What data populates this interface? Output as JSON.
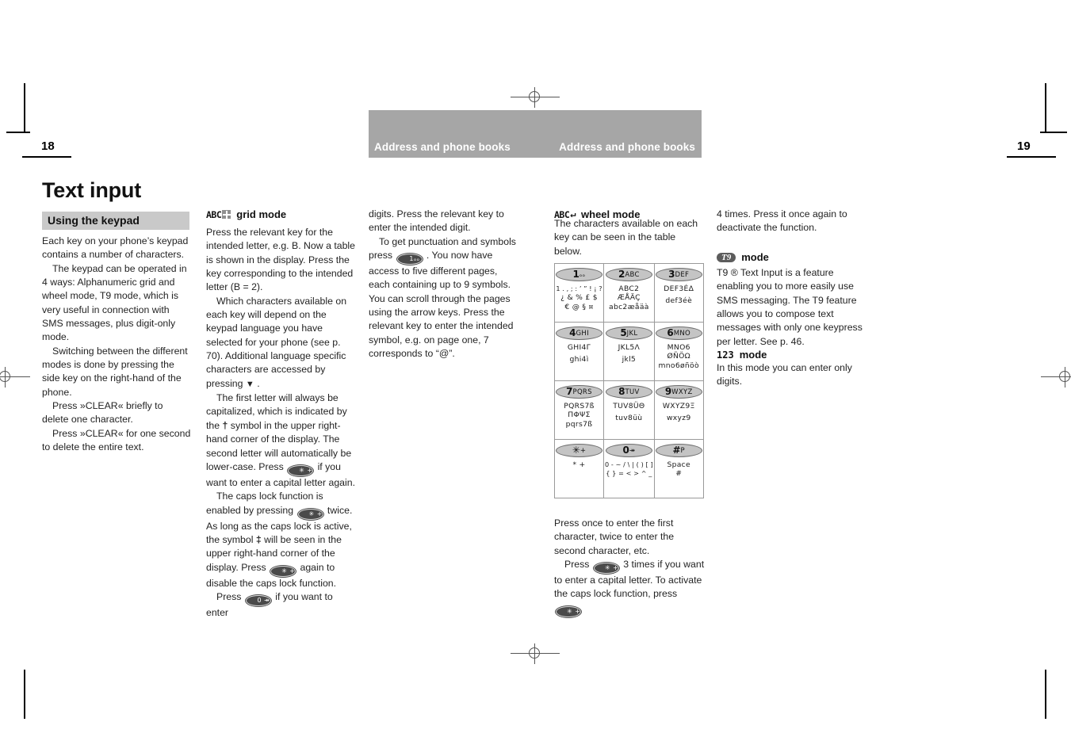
{
  "header": {
    "band_left_title": "Address and phone books",
    "band_right_title": "Address and phone books",
    "folio_left": "18",
    "folio_right": "19"
  },
  "page_title": "Text input",
  "section_band": "Using the keypad",
  "columns": {
    "col1": [
      "Each key on your phone’s keypad contains a number of characters.",
      "The keypad can be operated in 4 ways: Alphanumeric grid and wheel mode, T9 mode, which is very useful in connection with SMS messages, plus digit-only mode.",
      "Switching between the different modes is done by pressing the side key on the right-hand of the phone.",
      "Press »CLEAR« briefly to delete one character.",
      "Press »CLEAR« for one second to delete the entire text."
    ],
    "grid_mode_heading": "grid mode",
    "col2_p1": "Press the relevant key for the intended letter, e.g. B. Now a table is shown in the display. Press the key corresponding to the intended letter (B = 2).",
    "col2_p2_a": "Which characters available on each key will depend on the keypad language you have selected for your phone (see p. 70). Additional language specific characters are accessed by pressing",
    "col2_p2_b": ".",
    "col2_p3_a": "The first letter will always be capitalized, which is indicated by the",
    "col2_p3_b": "symbol in the upper right-hand corner of the display. The second letter will automatically be lower-case. Press",
    "col2_p3_c": "if you want to enter a capital letter again.",
    "col2_p4_a": "The caps lock function is enabled by pressing",
    "col2_p4_b": "twice. As long as the caps lock is active, the symbol",
    "col2_p4_c": "will be seen in the upper right-hand corner of the display. Press",
    "col2_p4_d": "again to disable the caps lock function.",
    "col2_p5_a": "Press",
    "col2_p5_b": "if you want to enter",
    "col3_p1": "digits. Press the relevant key to enter the intended digit.",
    "col3_p2_a": "To get punctuation and symbols press",
    "col3_p2_b": ". You now have access to five different pages, each containing up to 9 symbols. You can scroll through the pages using the arrow keys. Press the relevant key to enter the intended symbol, e.g. on page one, 7 corresponds to “@”.",
    "wheel_mode_heading": "wheel mode",
    "col4_p1": "The characters available on each key can be seen in the table below.",
    "col4_p2": "Press once to enter the first character, twice to enter the second character, etc.",
    "col4_p3_a": "Press",
    "col4_p3_b": "3 times if you want to enter a capital letter. To activate the caps lock function, press",
    "col5_p1": "4 times. Press it once again to deactivate the function.",
    "t9_mode_heading": "mode",
    "t9_badge": "T9",
    "col5_t9": "T9 ® Text Input is a feature enabling you to more easily use SMS messaging. The T9 feature allows you to compose text messages with only one keypress per letter. See p. 46.",
    "mode_123_badge": "123",
    "mode_123_heading": "mode",
    "col5_123": "In this mode you can enter only digits."
  },
  "inline_keys": {
    "star": "✳ +",
    "zero": "0 ↠",
    "one": "1ₒₒ",
    "arrow_down": "▼",
    "dagger": "†",
    "dagger_lock": "‡"
  },
  "keypad_table": {
    "rows": [
      [
        {
          "name": "key-1",
          "cap_digit": "1",
          "cap_letters": "ₒₒ",
          "lines": [
            "1 . , ; : ’ ” ! ¡ ?",
            "¿ & % £ $",
            "€ @ § ¤"
          ]
        },
        {
          "name": "key-2",
          "cap_digit": "2",
          "cap_letters": "ABC",
          "lines": [
            "ABC2",
            "ÆÅÄÇ",
            "abc2æåäà"
          ]
        },
        {
          "name": "key-3",
          "cap_digit": "3",
          "cap_letters": "DEF",
          "lines": [
            "DEF3ÉΔ",
            "",
            "def3éè"
          ]
        }
      ],
      [
        {
          "name": "key-4",
          "cap_digit": "4",
          "cap_letters": "GHI",
          "lines": [
            "GHI4Γ",
            "",
            "ghi4ì"
          ]
        },
        {
          "name": "key-5",
          "cap_digit": "5",
          "cap_letters": "JKL",
          "lines": [
            "JKL5Λ",
            "",
            "jkl5"
          ]
        },
        {
          "name": "key-6",
          "cap_digit": "6",
          "cap_letters": "MNO",
          "lines": [
            "MNO6",
            "ØÑÖΩ",
            "mno6øñöò"
          ]
        }
      ],
      [
        {
          "name": "key-7",
          "cap_digit": "7",
          "cap_letters": "PQRS",
          "lines": [
            "PQRS7ß",
            "ΠΦΨΣ",
            "pqrs7ß"
          ]
        },
        {
          "name": "key-8",
          "cap_digit": "8",
          "cap_letters": "TUV",
          "lines": [
            "TUV8ÜΘ",
            "",
            "tuv8üù"
          ]
        },
        {
          "name": "key-9",
          "cap_digit": "9",
          "cap_letters": "WXYZ",
          "lines": [
            "WXYZ9Ξ",
            "",
            "wxyz9"
          ]
        }
      ],
      [
        {
          "name": "key-star",
          "cap_digit": "✳",
          "cap_letters": "+",
          "lines": [
            "*   +",
            "",
            ""
          ]
        },
        {
          "name": "key-0",
          "cap_digit": "0",
          "cap_letters": "↠",
          "lines": [
            "0 - ~ / \\ | ( ) [ ]",
            "{ } = < > ^ _",
            ""
          ]
        },
        {
          "name": "key-hash",
          "cap_digit": "#",
          "cap_letters": "P",
          "lines": [
            "Space",
            "#",
            ""
          ]
        }
      ]
    ]
  }
}
